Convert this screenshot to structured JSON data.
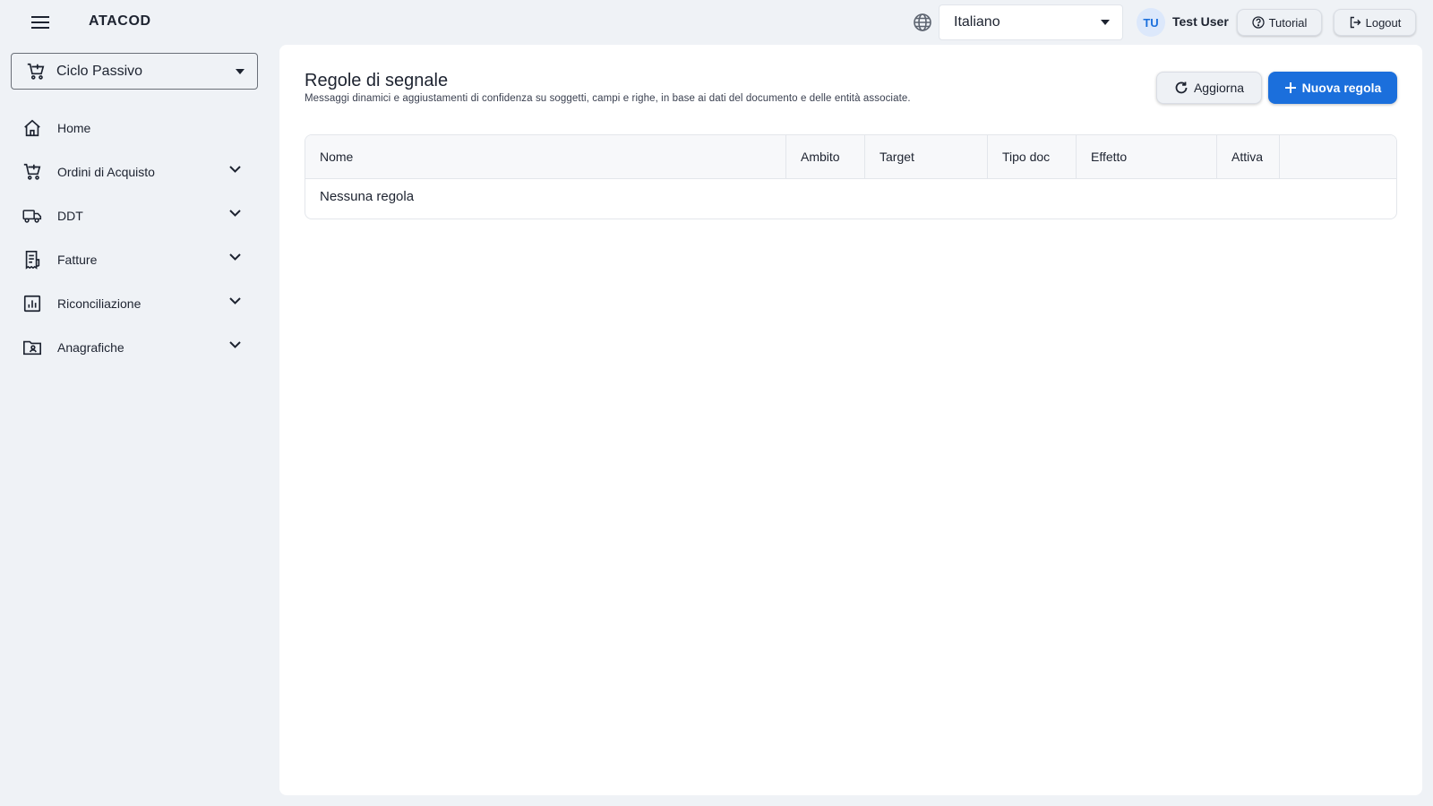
{
  "header": {
    "brand": "ATACOD",
    "language": {
      "selected": "Italiano"
    },
    "user": {
      "initials": "TU",
      "name": "Test User"
    },
    "tutorial_label": "Tutorial",
    "logout_label": "Logout",
    "accent_color": "#1b6fdc"
  },
  "sidebar": {
    "module": {
      "selected": "Ciclo Passivo",
      "icon": "cart-icon"
    },
    "items": [
      {
        "label": "Home",
        "icon": "home-icon",
        "expandable": false
      },
      {
        "label": "Ordini di Acquisto",
        "icon": "cart-icon",
        "expandable": true
      },
      {
        "label": "DDT",
        "icon": "truck-icon",
        "expandable": true
      },
      {
        "label": "Fatture",
        "icon": "receipt-icon",
        "expandable": true
      },
      {
        "label": "Riconciliazione",
        "icon": "chart-icon",
        "expandable": true
      },
      {
        "label": "Anagrafiche",
        "icon": "folder-user-icon",
        "expandable": true
      }
    ]
  },
  "main": {
    "title": "Regole di segnale",
    "subtitle": "Messaggi dinamici e aggiustamenti di confidenza su soggetti, campi e righe, in base ai dati del documento e delle entità associate.",
    "refresh_label": "Aggiorna",
    "new_label": "Nuova regola",
    "table": {
      "columns": [
        "Nome",
        "Ambito",
        "Target",
        "Tipo doc",
        "Effetto",
        "Attiva",
        ""
      ],
      "rows": [],
      "empty_text": "Nessuna regola"
    }
  }
}
